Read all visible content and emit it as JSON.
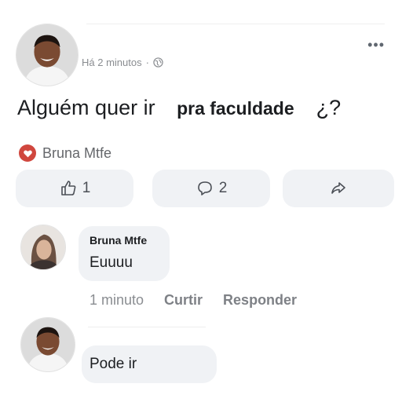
{
  "post": {
    "time": "Há 2 minutos",
    "separator": "·",
    "text_before": "Alguém quer ir ",
    "text_pasted": "pra faculdade",
    "text_after": "¿?",
    "more_label": "•••"
  },
  "reactions": {
    "name": "Bruna Mtfe",
    "heart_color": "#d0473e"
  },
  "actions": {
    "like_count": "1",
    "comment_count": "2"
  },
  "comment": {
    "author": "Bruna Mtfe",
    "text": "Euuuu",
    "time": "1 minuto",
    "like_label": "Curtir",
    "reply_label": "Responder"
  },
  "reply": {
    "text": "Pode ir"
  },
  "icons": {
    "globe": "globe-icon",
    "more": "more-icon",
    "heart": "heart-icon",
    "like": "thumbs-up-icon",
    "comment": "comment-icon",
    "share": "share-icon"
  }
}
